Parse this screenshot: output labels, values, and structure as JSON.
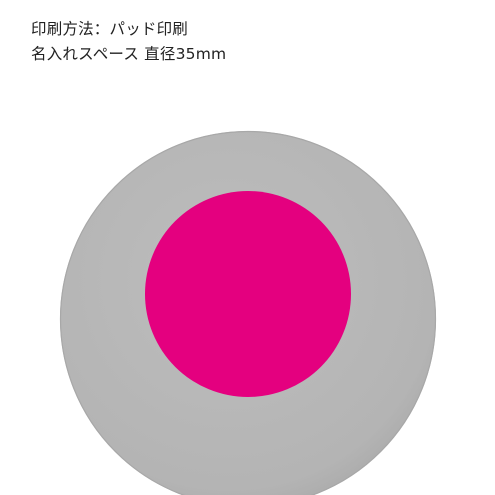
{
  "caption": {
    "print_method": "印刷方法：パッド印刷",
    "name_space": "名入れスペース 直径35mm"
  },
  "colors": {
    "disc": "#b5b5b5",
    "disc_edge": "#a8a8a8",
    "print_area": "#e4007f"
  }
}
